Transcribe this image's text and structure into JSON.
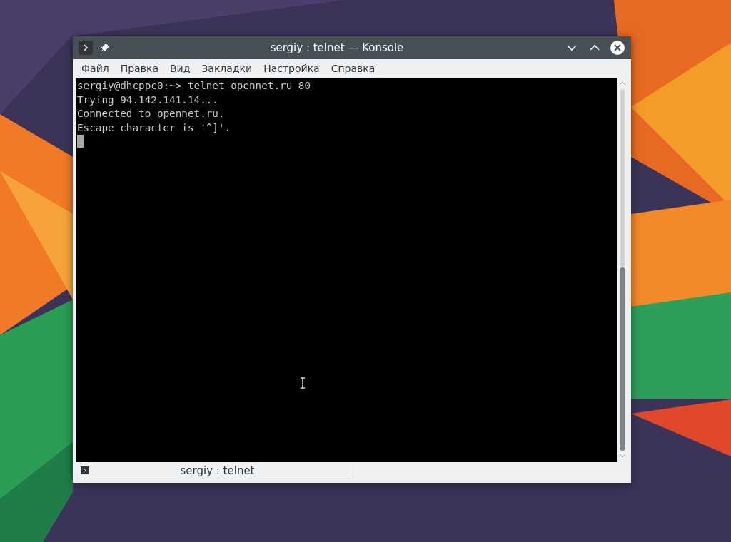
{
  "window": {
    "title": "sergiy : telnet — Konsole"
  },
  "menu": [
    {
      "label": "Файл"
    },
    {
      "label": "Правка"
    },
    {
      "label": "Вид"
    },
    {
      "label": "Закладки"
    },
    {
      "label": "Настройка"
    },
    {
      "label": "Справка"
    }
  ],
  "terminal": {
    "lines": [
      "sergiy@dhcppc0:~> telnet opennet.ru 80",
      "Trying 94.142.141.14...",
      "Connected to opennet.ru.",
      "Escape character is '^]'."
    ]
  },
  "tabs": [
    {
      "label": "sergiy : telnet",
      "selected": true
    }
  ]
}
